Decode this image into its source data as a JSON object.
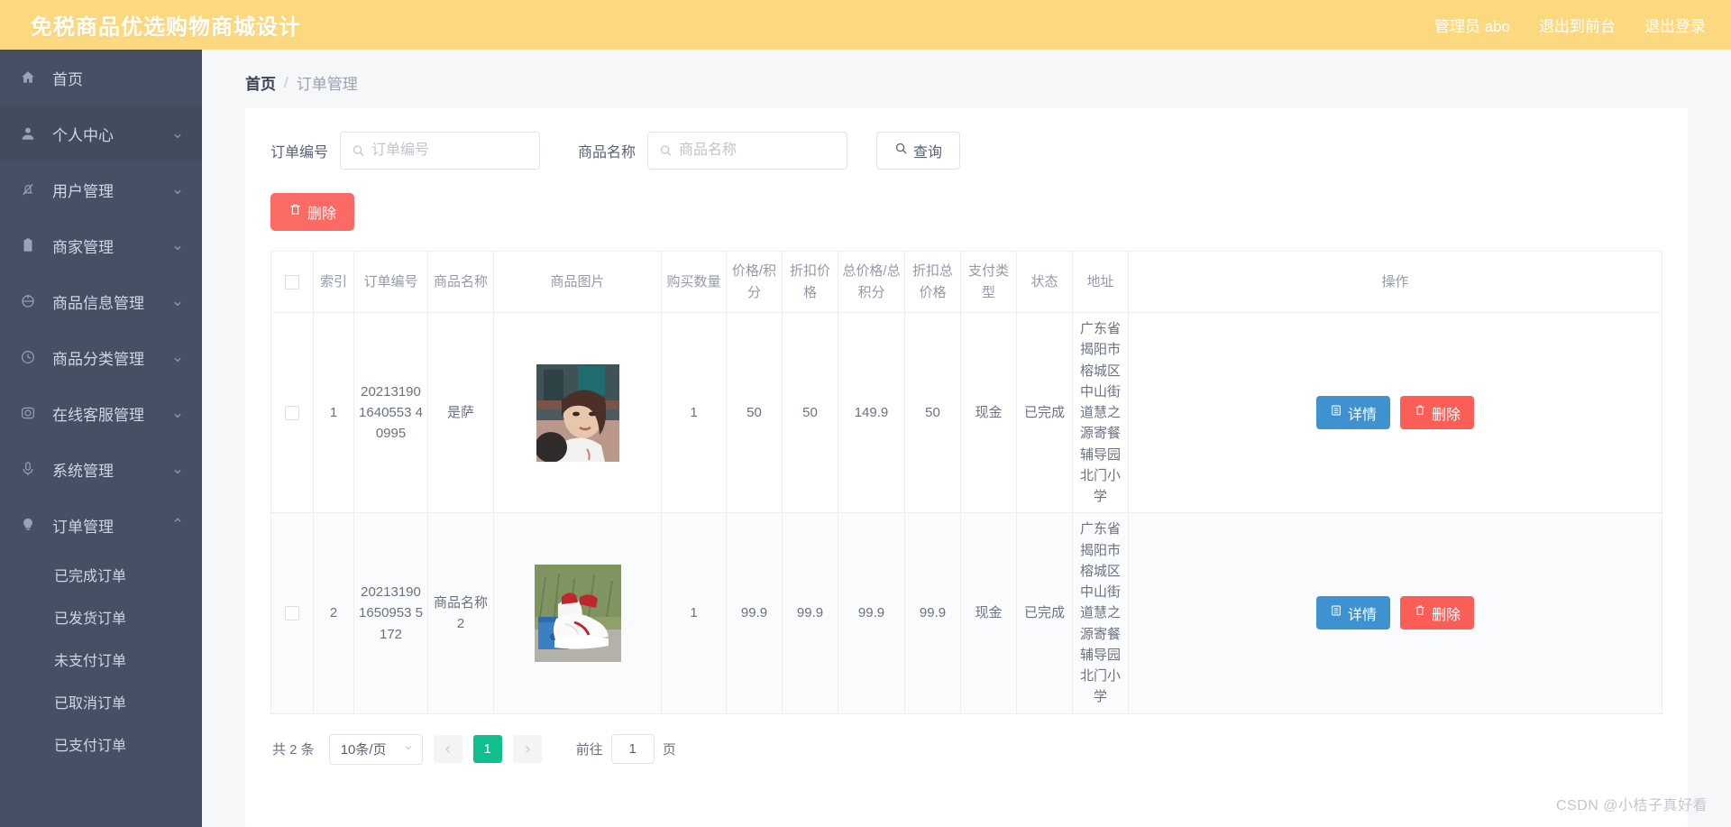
{
  "header": {
    "brand": "免税商品优选购物商城设计",
    "admin_label": "管理员 abo",
    "logout_front_label": "退出到前台",
    "logout_label": "退出登录"
  },
  "sidebar": {
    "items": [
      {
        "label": "首页",
        "icon": "home-icon",
        "arrow": "",
        "active": true
      },
      {
        "label": "个人中心",
        "icon": "user-icon",
        "arrow": "⌄",
        "active": false
      },
      {
        "label": "用户管理",
        "icon": "bell-off-icon",
        "arrow": "⌄",
        "active": false
      },
      {
        "label": "商家管理",
        "icon": "clipboard-icon",
        "arrow": "⌄",
        "active": false
      },
      {
        "label": "商品信息管理",
        "icon": "aim-icon",
        "arrow": "⌄",
        "active": false
      },
      {
        "label": "商品分类管理",
        "icon": "clock-icon",
        "arrow": "⌄",
        "active": false
      },
      {
        "label": "在线客服管理",
        "icon": "camera-icon",
        "arrow": "⌄",
        "active": false
      },
      {
        "label": "系统管理",
        "icon": "microphone-icon",
        "arrow": "⌄",
        "active": false
      },
      {
        "label": "订单管理",
        "icon": "bulb-icon",
        "arrow": "⌃",
        "active": false
      }
    ],
    "submenu": [
      {
        "label": "已完成订单"
      },
      {
        "label": "已发货订单"
      },
      {
        "label": "未支付订单"
      },
      {
        "label": "已取消订单"
      },
      {
        "label": "已支付订单"
      }
    ]
  },
  "breadcrumb": {
    "home": "首页",
    "separator": "/",
    "current": "订单管理"
  },
  "search": {
    "order_label": "订单编号",
    "order_placeholder": "订单编号",
    "order_value": "",
    "product_label": "商品名称",
    "product_placeholder": "商品名称",
    "product_value": "",
    "query_label": "查询",
    "query_icon": "search-icon"
  },
  "toolbar": {
    "delete_label": "删除",
    "delete_icon": "trash-icon",
    "delete_color": "#fb6a64"
  },
  "table": {
    "columns": [
      "",
      "索引",
      "订单编号",
      "商品名称",
      "商品图片",
      "购买数量",
      "价格/积分",
      "折扣价格",
      "总价格/总积分",
      "折扣总价格",
      "支付类型",
      "状态",
      "地址",
      "操作"
    ],
    "rows": [
      {
        "index": "1",
        "order_no": "202131901640553 40995",
        "product_name": "是萨",
        "image": "woman-photo",
        "quantity": "1",
        "price_points": "50",
        "discount_price": "50",
        "total_price_points": "149.9",
        "discount_total_price": "50",
        "pay_type": "现金",
        "status": "已完成",
        "address": "广东省揭阳市榕城区中山街道慧之源寄餐辅导园北门小学",
        "detail_label": "详情",
        "delete_label": "删除"
      },
      {
        "index": "2",
        "order_no": "202131901650953 5172",
        "product_name": "商品名称2",
        "image": "shoes-photo",
        "quantity": "1",
        "price_points": "99.9",
        "discount_price": "99.9",
        "total_price_points": "99.9",
        "discount_total_price": "99.9",
        "pay_type": "现金",
        "status": "已完成",
        "address": "广东省揭阳市榕城区中山街道慧之源寄餐辅导园北门小学",
        "detail_label": "详情",
        "delete_label": "删除"
      }
    ],
    "detail_icon": "document-icon",
    "delete_icon": "trash-icon"
  },
  "pagination": {
    "total_text": "共 2 条",
    "page_size": "10条/页",
    "prev_icon": "chevron-left-icon",
    "next_icon": "chevron-right-icon",
    "current_page": "1",
    "goto_prefix": "前往",
    "goto_value": "1",
    "goto_suffix": "页"
  },
  "watermark": "CSDN @小桔子真好看",
  "colors": {
    "header_bg": "#fcd87f",
    "sidebar_bg": "#474f64",
    "accent_green": "#0fbf8f",
    "danger": "#fb5e56",
    "primary_blue": "#3e92d0"
  }
}
